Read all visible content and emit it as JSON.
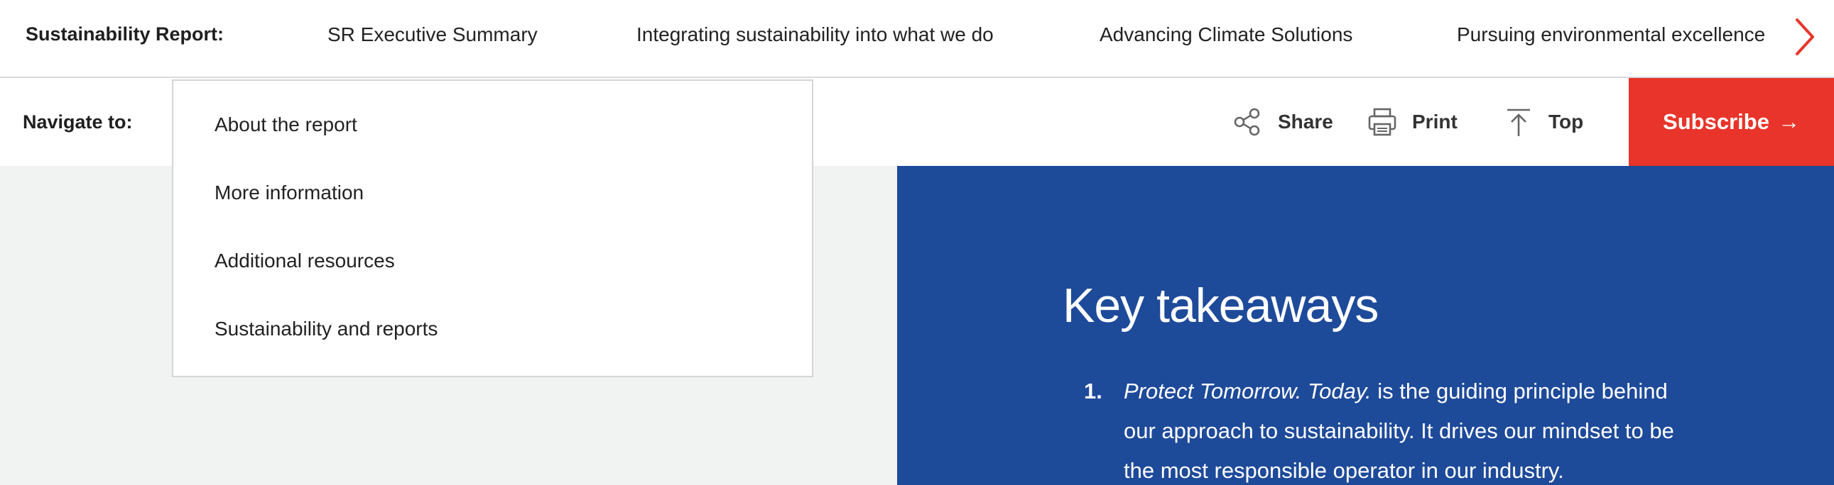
{
  "topbar": {
    "label": "Sustainability Report:",
    "links": [
      "SR Executive Summary",
      "Integrating sustainability into what we do",
      "Advancing Climate Solutions",
      "Pursuing environmental excellence"
    ],
    "next_icon": "chevron-right-icon"
  },
  "navbar": {
    "label": "Navigate to:",
    "actions": {
      "share": {
        "label": "Share",
        "icon": "share-icon"
      },
      "print": {
        "label": "Print",
        "icon": "printer-icon"
      },
      "top": {
        "label": "Top",
        "icon": "arrow-up-to-line-icon"
      }
    },
    "subscribe": {
      "label": "Subscribe",
      "arrow": "→"
    }
  },
  "dropdown": {
    "items": [
      "About the report",
      "More information",
      "Additional resources",
      "Sustainability and reports"
    ]
  },
  "key_takeaways": {
    "title": "Key takeaways",
    "items": [
      {
        "number": "1.",
        "emphasis": "Protect Tomorrow. Today.",
        "text": " is the guiding principle behind our approach to sustainability. It drives our mindset to be the most responsible operator in our industry."
      }
    ]
  },
  "colors": {
    "accent_red": "#e8342a",
    "panel_blue": "#1e4a9a",
    "content_grey": "#f1f2f2"
  }
}
